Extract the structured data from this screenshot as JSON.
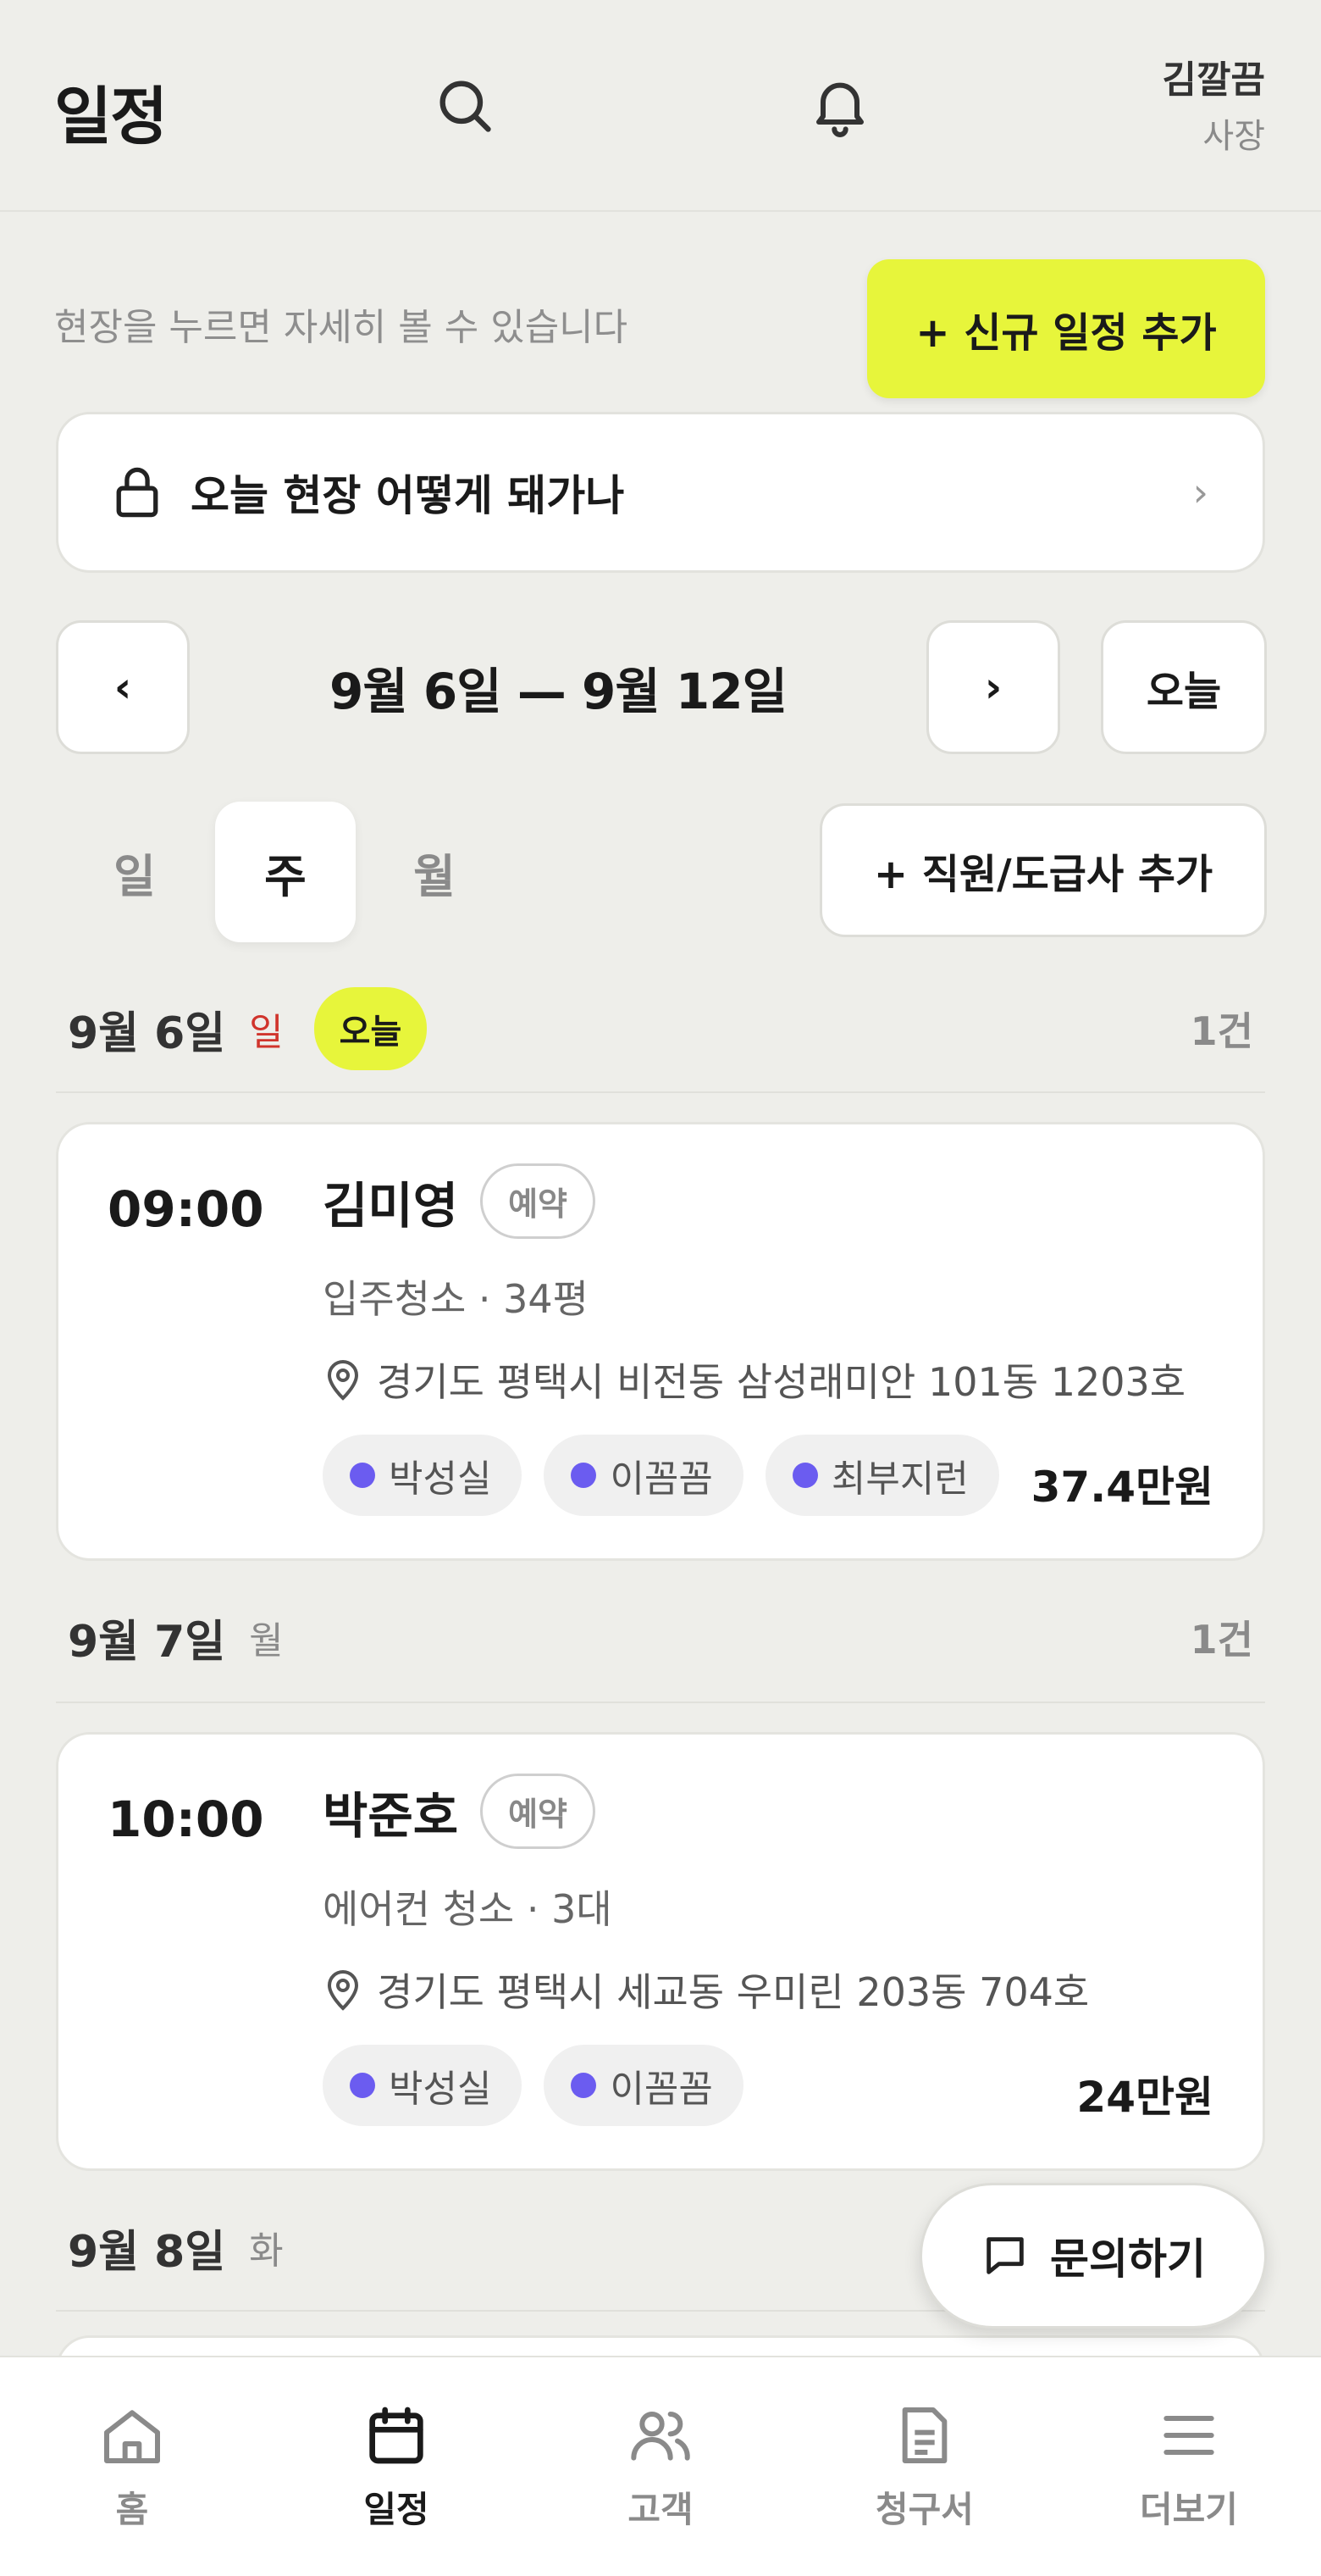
{
  "header": {
    "title": "일정",
    "user_name": "김깔끔",
    "user_role": "사장"
  },
  "hint": "현장을 누르면 자세히 볼 수 있습니다",
  "new_schedule_label": "+ 신규 일정 추가",
  "notice": {
    "text": "오늘 현장 어떻게 돼가나",
    "chevron": "›"
  },
  "date_nav": {
    "prev": "‹",
    "range": "9월 6일 — 9월 12일",
    "next": "›",
    "today": "오늘"
  },
  "view_tabs": [
    {
      "label": "일"
    },
    {
      "label": "주"
    },
    {
      "label": "월"
    }
  ],
  "active_tab": "주",
  "add_staff_label": "+ 직원/도급사 추가",
  "days": [
    {
      "date": "9월 6일",
      "weekday": "일",
      "badge": "오늘",
      "count": "1건",
      "jobs": [
        {
          "time": "09:00",
          "customer": "김미영",
          "status": "예약",
          "service": "입주청소 · 34평",
          "address": "경기도 평택시 비전동 삼성래미안 101동 1203호",
          "staff": [
            "박성실",
            "이꼼꼼",
            "최부지런"
          ],
          "price": "37.4만원"
        }
      ]
    },
    {
      "date": "9월 7일",
      "weekday": "월",
      "count": "1건",
      "jobs": [
        {
          "time": "10:00",
          "customer": "박준호",
          "status": "예약",
          "service": "에어컨 청소 · 3대",
          "address": "경기도 평택시 세교동 우미린 203동 704호",
          "staff": [
            "박성실",
            "이꼼꼼"
          ],
          "price": "24만원"
        }
      ]
    },
    {
      "date": "9월 8일",
      "weekday": "화"
    }
  ],
  "inquiry_label": "문의하기",
  "bottom_nav": [
    {
      "label": "홈",
      "icon": "home-icon"
    },
    {
      "label": "일정",
      "icon": "calendar-icon"
    },
    {
      "label": "고객",
      "icon": "users-icon"
    },
    {
      "label": "청구서",
      "icon": "document-icon"
    },
    {
      "label": "더보기",
      "icon": "menu-icon"
    }
  ],
  "colors": {
    "accent": "#E7F53B",
    "staff_dot": "#6B5CF0",
    "sunday": "#D0342C",
    "background": "#EEEEEA"
  }
}
